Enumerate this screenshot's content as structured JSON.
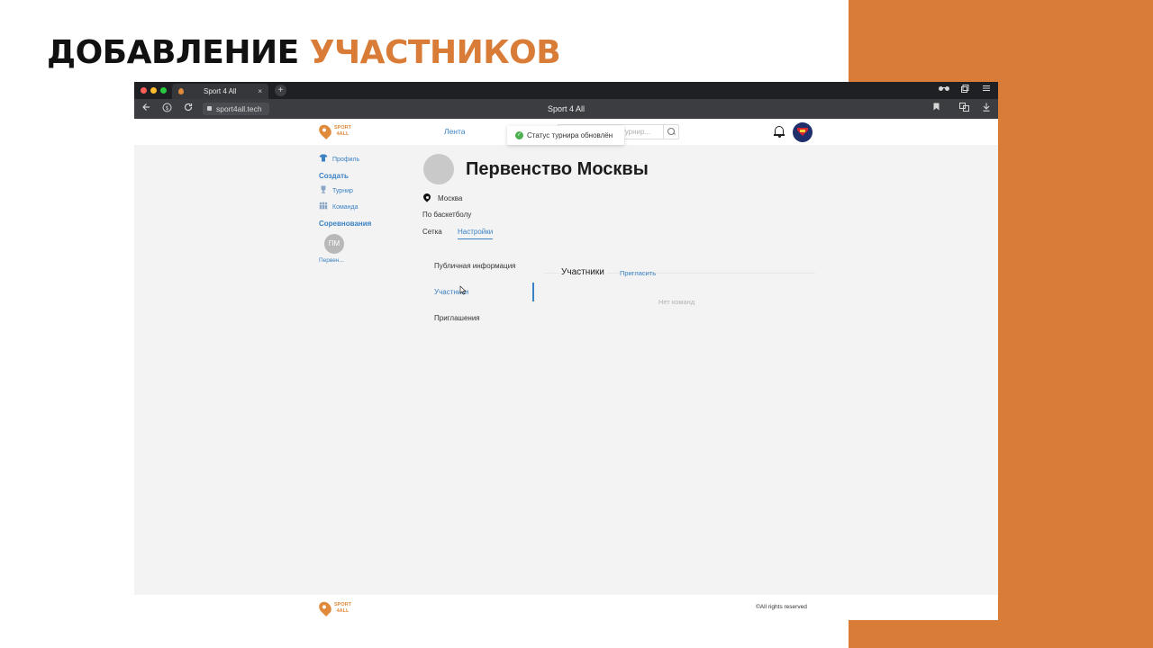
{
  "slide": {
    "title_main": "ДОБАВЛЕНИЕ ",
    "title_accent": "УЧАСТНИКОВ",
    "accent_color": "#d97c37"
  },
  "browser": {
    "tab_title": "Sport 4 All",
    "tab_close": "×",
    "new_tab": "+",
    "url": "sport4all.tech",
    "window_title": "Sport 4 All",
    "icons": [
      "back-icon",
      "shield-icon",
      "reload-icon",
      "lock-icon",
      "reader-icon",
      "tabs-icon",
      "menu-icon",
      "bookmark-icon",
      "extensions-icon",
      "download-icon"
    ]
  },
  "site": {
    "logo_line1": "SPORT",
    "logo_line2": "4ALL",
    "nav_feed": "Лента",
    "search_placeholder": "турнир...",
    "toast": "Статус турнира обновлён",
    "toast_icon": "✓",
    "brand_color": "#e08a3c",
    "link_color": "#3b82c4"
  },
  "sidebar": {
    "profile": "Профиль",
    "create_header": "Создать",
    "tournament": "Турнир",
    "team": "Команда",
    "competitions_header": "Соревнования",
    "competition_initials": "ПМ",
    "competition_short": "Первен..."
  },
  "main": {
    "title": "Первенство Москвы",
    "city": "Москва",
    "sport": "По баскетболу",
    "tabs": [
      {
        "label": "Сетка",
        "active": false
      },
      {
        "label": "Настройки",
        "active": true
      }
    ]
  },
  "settings": {
    "nav": [
      {
        "label": "Публичная информация",
        "active": false
      },
      {
        "label": "Участники",
        "active": true
      },
      {
        "label": "Приглашения",
        "active": false
      }
    ],
    "participants_title": "Участники",
    "invite": "Пригласить",
    "empty": "Нет команд"
  },
  "footer": {
    "logo_line1": "SPORT",
    "logo_line2": "4ALL",
    "copyright": "©All rights reserved"
  }
}
